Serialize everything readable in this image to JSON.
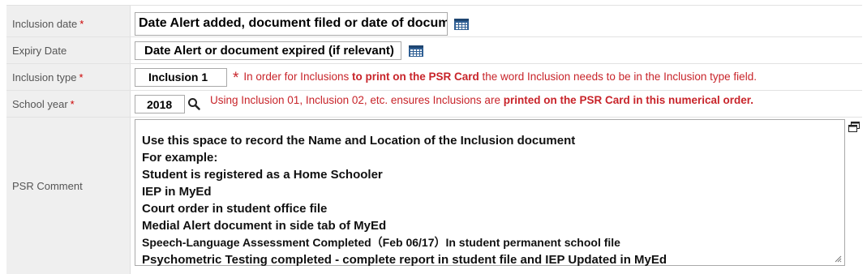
{
  "fields": {
    "inclusion_date": {
      "label": "Inclusion date",
      "required_mark": "*",
      "value": "Date Alert added, document filed or date of document"
    },
    "expiry_date": {
      "label": "Expiry Date",
      "value": "Date Alert or document expired (if relevant)"
    },
    "inclusion_type": {
      "label": "Inclusion type",
      "required_mark": "*",
      "value": "Inclusion 1",
      "note_star": "*",
      "note_pre": "In order for Inclusions ",
      "note_bold": "to print on the PSR Card",
      "note_post": " the word Inclusion needs to be in the Inclusion type field."
    },
    "school_year": {
      "label": "School year",
      "required_mark": "*",
      "value": "2018",
      "note_pre": "Using Inclusion 01, Inclusion 02, etc. ensures Inclusions are ",
      "note_bold": "printed on the PSR Card in this numerical order."
    },
    "psr_comment": {
      "label": "PSR Comment",
      "lines": [
        "Use this space to record the Name and Location of the Inclusion document",
        "For example:",
        "Student is registered as a Home Schooler",
        "IEP in MyEd",
        "Court order in student office file",
        "Medial Alert document in side tab of MyEd",
        "Speech-Language Assessment Completed（Feb 06/17）In student permanent school file",
        "Psychometric Testing completed - complete report in student file and IEP Updated in MyEd"
      ]
    }
  },
  "icons": {
    "calendar": "calendar-icon",
    "search": "magnifier-icon",
    "popout": "popout-icon",
    "resize": "resize-grip-icon"
  },
  "colors": {
    "note_red": "#c8242a",
    "required_red": "#cc0000",
    "label_bg": "#efefef"
  }
}
